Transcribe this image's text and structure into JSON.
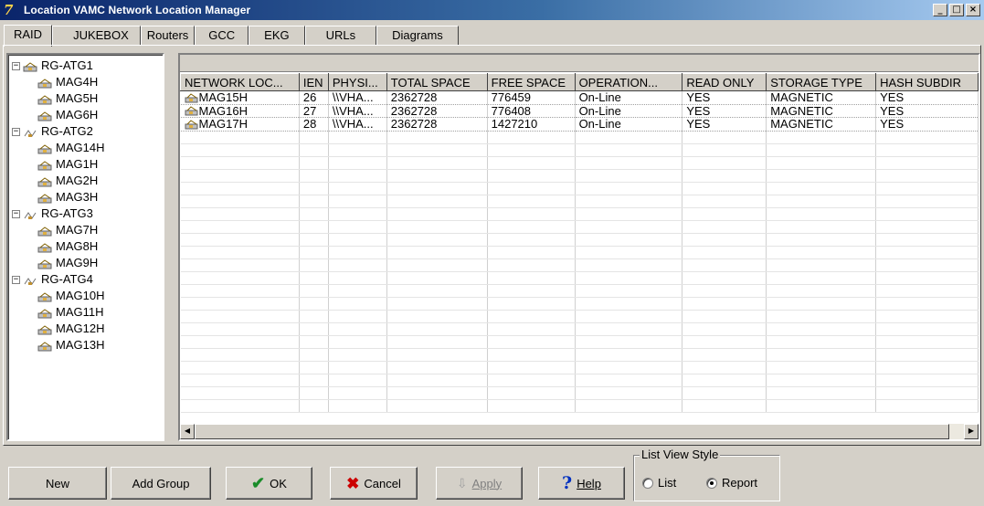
{
  "window": {
    "title": "Location  VAMC Network Location Manager",
    "icon": "app-logo-icon",
    "controls": [
      "_",
      "□",
      "×"
    ]
  },
  "tabs": [
    {
      "label": "RAID",
      "active": true
    },
    {
      "label": "JUKEBOX",
      "active": false
    },
    {
      "label": "Routers",
      "active": false
    },
    {
      "label": "GCC",
      "active": false
    },
    {
      "label": "EKG",
      "active": false
    },
    {
      "label": "URLs",
      "active": false
    },
    {
      "label": "Diagrams",
      "active": false
    }
  ],
  "tree": [
    {
      "label": "RG-ATG1",
      "expander": "−",
      "children": [
        "MAG4H",
        "MAG5H",
        "MAG6H"
      ]
    },
    {
      "label": "RG-ATG2",
      "expander": "−",
      "children": [
        "MAG14H",
        "MAG1H",
        "MAG2H",
        "MAG3H"
      ]
    },
    {
      "label": "RG-ATG3",
      "expander": "−",
      "children": [
        "MAG7H",
        "MAG8H",
        "MAG9H"
      ]
    },
    {
      "label": "RG-ATG4",
      "expander": "−",
      "children": [
        "MAG10H",
        "MAG11H",
        "MAG12H",
        "MAG13H"
      ]
    }
  ],
  "grid": {
    "columns": [
      "NETWORK LOC...",
      "IEN",
      "PHYSI...",
      "TOTAL SPACE",
      "FREE SPACE",
      "OPERATION...",
      "READ ONLY",
      "STORAGE TYPE",
      "HASH SUBDIR"
    ],
    "rows": [
      [
        "MAG15H",
        "26",
        "\\\\VHA...",
        "2362728",
        "776459",
        "On-Line",
        "YES",
        "MAGNETIC",
        "YES"
      ],
      [
        "MAG16H",
        "27",
        "\\\\VHA...",
        "2362728",
        "776408",
        "On-Line",
        "YES",
        "MAGNETIC",
        "YES"
      ],
      [
        "MAG17H",
        "28",
        "\\\\VHA...",
        "2362728",
        "1427210",
        "On-Line",
        "YES",
        "MAGNETIC",
        "YES"
      ]
    ]
  },
  "buttons": {
    "new": "New",
    "add_group": "Add Group",
    "ok": "OK",
    "cancel": "Cancel",
    "apply": "Apply",
    "help": "Help"
  },
  "list_view_style": {
    "title": "List View Style",
    "options": [
      "List",
      "Report"
    ],
    "selected": "Report"
  },
  "colors": {
    "titlebar": "#0a246a",
    "face": "#d4d0c8",
    "ok_check": "#1a8c2a",
    "cancel_x": "#cc0000",
    "help_q": "#0030c0"
  }
}
